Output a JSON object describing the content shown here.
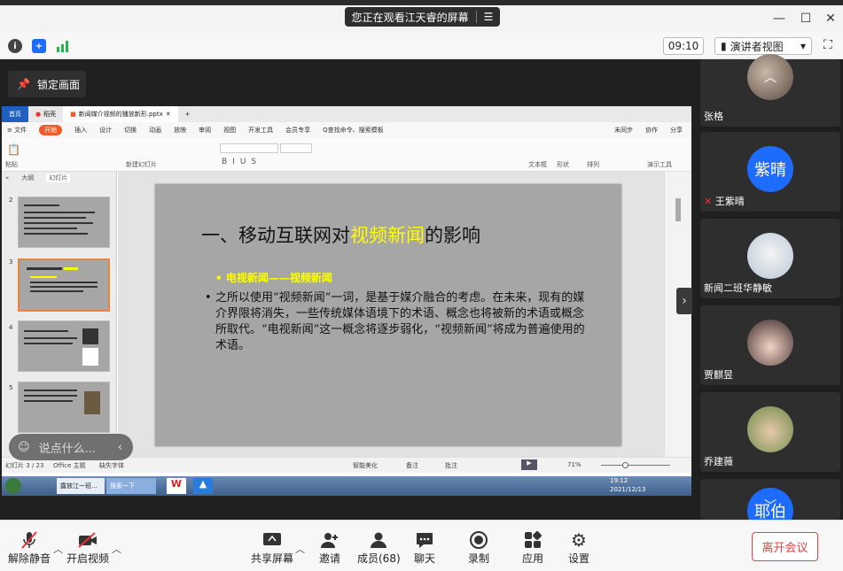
{
  "banner": {
    "text": "您正在观看江天睿的屏幕"
  },
  "header": {
    "clock": "09:10",
    "view_mode": "演讲者视图"
  },
  "stage": {
    "lock_label": "锁定画面",
    "chat_placeholder": "说点什么..."
  },
  "wps": {
    "tabs": [
      {
        "label": "首页"
      },
      {
        "label": "稻壳"
      },
      {
        "label": "新闻媒介视频的播放新形.pptx"
      }
    ],
    "menu": [
      "≡ 文件",
      "开始",
      "插入",
      "设计",
      "切换",
      "动画",
      "放映",
      "审阅",
      "视图",
      "开发工具",
      "会员专享",
      "Q查找命令、搜索模板"
    ],
    "menu_right": [
      "未同步",
      "协作",
      "分享"
    ],
    "ribbon": {
      "paste": "粘贴",
      "new_slide": "新建幻灯片",
      "textbox": "文本框",
      "shape": "形状",
      "arrange": "排列",
      "play": "演示工具"
    },
    "pane_tabs": [
      "大纲",
      "幻灯片"
    ],
    "thumb_numbers": [
      "2",
      "3",
      "4",
      "5"
    ],
    "slide": {
      "title_pre": "一、移动互联网对",
      "title_hl": "视频新闻",
      "title_post": "的影响",
      "bullet1": "电视新闻——视频新闻",
      "bullet2": "之所以使用“视频新闻”一词，是基于媒介融合的考虑。在未来，现有的媒介界限将消失，一些传统媒体语境下的术语、概念也将被新的术语或概念所取代。“电视新闻”这一概念将逐步弱化，“视频新闻”将成为普遍使用的术语。"
    },
    "status": {
      "slide_count": "幻灯片 3 / 23",
      "theme": "Office 主题",
      "font": "缺失字体",
      "beautify": "智能美化",
      "notes": "备注",
      "comment": "批注",
      "zoom": "71%"
    },
    "taskbar": {
      "items": [
        "露放江一班...",
        "搜索一下"
      ],
      "time": "19:12",
      "date": "2021/12/13"
    }
  },
  "participants": [
    {
      "name": "张格",
      "avatar": "photo"
    },
    {
      "name": "王紫晴",
      "avatar_text": "紫晴",
      "avatar_color": "#1e6bff"
    },
    {
      "name": "新闻二班华静敏",
      "avatar": "photo"
    },
    {
      "name": "贾麒昱",
      "avatar": "photo"
    },
    {
      "name": "乔建薇",
      "avatar": "photo"
    },
    {
      "name": "",
      "avatar_text": "耶伯",
      "avatar_color": "#1e6bff"
    }
  ],
  "toolbar": {
    "mute": "解除静音",
    "video": "开启视频",
    "share": "共享屏幕",
    "invite": "邀请",
    "members": "成员(68)",
    "chat": "聊天",
    "record": "录制",
    "apps": "应用",
    "settings": "设置",
    "leave": "离开会议"
  },
  "colors": {
    "accent": "#1e6bff",
    "leave": "#e04444",
    "highlight": "#ffff00"
  }
}
